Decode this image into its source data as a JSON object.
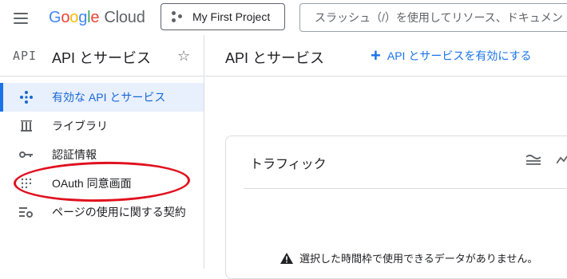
{
  "topbar": {
    "logo_letters": [
      "G",
      "o",
      "o",
      "g",
      "l",
      "e"
    ],
    "logo_product": "Cloud",
    "project_label": "My First Project",
    "search_placeholder": "スラッシュ（/）を使用してリソース、ドキュメン"
  },
  "sidebar": {
    "logo_text": "API",
    "title": "API とサービス",
    "items": [
      {
        "label": "有効な API とサービス",
        "icon": "diamond-dots-icon",
        "active": true
      },
      {
        "label": "ライブラリ",
        "icon": "library-icon",
        "active": false
      },
      {
        "label": "認証情報",
        "icon": "key-icon",
        "active": false
      },
      {
        "label": "OAuth 同意画面",
        "icon": "consent-icon",
        "active": false
      },
      {
        "label": "ページの使用に関する契約",
        "icon": "settings-list-icon",
        "active": false
      }
    ]
  },
  "main": {
    "title": "API とサービス",
    "enable_button": "API とサービスを有効にする"
  },
  "traffic_card": {
    "title": "トラフィック",
    "no_data_message": "選択した時間枠で使用できるデータがありません。"
  },
  "colors": {
    "accent": "#1a73e8",
    "active_bg": "#e8f0fe",
    "annotation": "#e0101e"
  }
}
